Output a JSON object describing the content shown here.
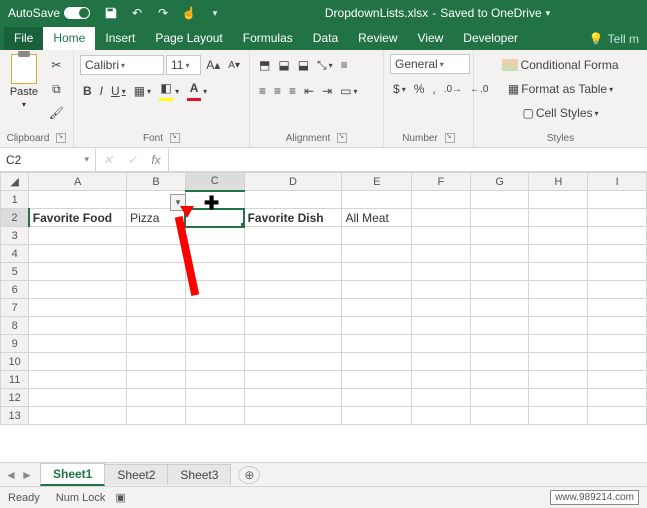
{
  "titlebar": {
    "autosave_label": "AutoSave",
    "autosave_on": "On",
    "filename": "DropdownLists.xlsx",
    "save_status": "Saved to OneDrive"
  },
  "tabs": {
    "file": "File",
    "home": "Home",
    "insert": "Insert",
    "page_layout": "Page Layout",
    "formulas": "Formulas",
    "data": "Data",
    "review": "Review",
    "view": "View",
    "developer": "Developer",
    "tell_me": "Tell m"
  },
  "ribbon": {
    "clipboard": {
      "label": "Clipboard",
      "paste": "Paste"
    },
    "font": {
      "label": "Font",
      "name": "Calibri",
      "size": "11",
      "bold": "B",
      "italic": "I",
      "underline": "U"
    },
    "alignment": {
      "label": "Alignment"
    },
    "number": {
      "label": "Number",
      "format": "General"
    },
    "styles": {
      "label": "Styles",
      "conditional": "Conditional Forma",
      "table": "Format as Table",
      "cell": "Cell Styles"
    }
  },
  "formula_bar": {
    "name_box": "C2",
    "fx": "fx",
    "formula": ""
  },
  "grid": {
    "columns": [
      "A",
      "B",
      "C",
      "D",
      "E",
      "F",
      "G",
      "H",
      "I"
    ],
    "rows": [
      "1",
      "2",
      "3",
      "4",
      "5",
      "6",
      "7",
      "8",
      "9",
      "10",
      "11",
      "12",
      "13"
    ],
    "cells": {
      "A2": "Favorite Food",
      "B2": "Pizza",
      "D2": "Favorite Dish",
      "E2": "All Meat"
    },
    "selected_cell": "C2"
  },
  "sheets": {
    "s1": "Sheet1",
    "s2": "Sheet2",
    "s3": "Sheet3"
  },
  "statusbar": {
    "ready": "Ready",
    "numlock": "Num Lock"
  },
  "watermark": "www.989214.com"
}
